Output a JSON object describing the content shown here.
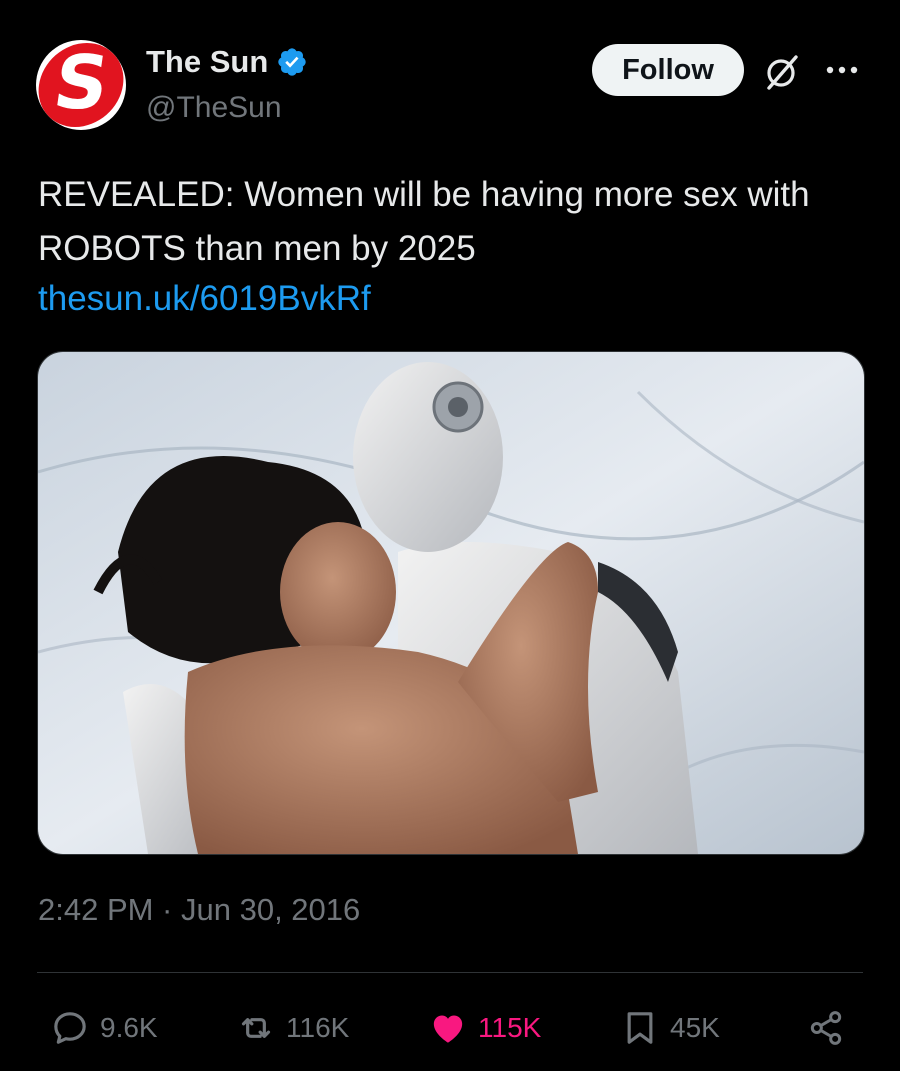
{
  "author": {
    "display_name": "The Sun",
    "handle": "@TheSun",
    "avatar_letter": "S",
    "avatar_color": "#e1141f",
    "verified": true,
    "verified_color": "#1d9bf0"
  },
  "header_actions": {
    "follow_label": "Follow",
    "grok_icon": "grok-icon",
    "more_icon": "more-horizontal-icon"
  },
  "tweet": {
    "text": "REVEALED: Women will be having more sex with ROBOTS than men by 2025",
    "link": "thesun.uk/6019BvkRf",
    "link_color": "#1d9bf0",
    "media": "image-photo",
    "timestamp": "2:42 PM · Jun 30, 2016"
  },
  "actions": {
    "replies": "9.6K",
    "reposts": "116K",
    "likes": "115K",
    "bookmarks": "45K",
    "like_color": "#f91880",
    "icons": [
      "reply-icon",
      "repost-icon",
      "like-heart-icon",
      "bookmark-icon",
      "share-icon"
    ]
  }
}
